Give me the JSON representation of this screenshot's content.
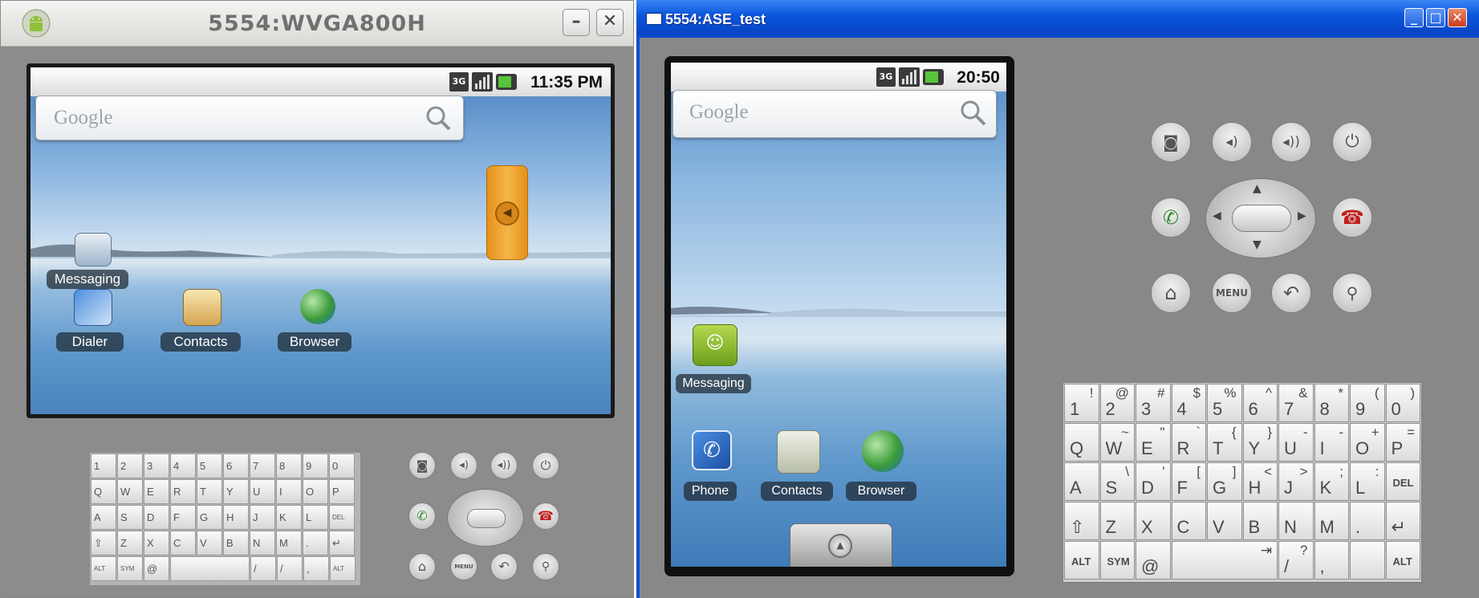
{
  "left_emulator": {
    "title": "5554:WVGA800H",
    "status_time": "11:35 PM",
    "search_placeholder": "Google",
    "apps": [
      {
        "label": "Messaging",
        "icon": "messaging-icon"
      },
      {
        "label": "Dialer",
        "icon": "dialer-icon"
      },
      {
        "label": "Contacts",
        "icon": "contacts-icon"
      },
      {
        "label": "Browser",
        "icon": "browser-icon"
      }
    ],
    "keyboard_rows": [
      [
        "1",
        "2",
        "3",
        "4",
        "5",
        "6",
        "7",
        "8",
        "9",
        "0"
      ],
      [
        "Q",
        "W",
        "E",
        "R",
        "T",
        "Y",
        "U",
        "I",
        "O",
        "P"
      ],
      [
        "A",
        "S",
        "D",
        "F",
        "G",
        "H",
        "J",
        "K",
        "L",
        "DEL"
      ],
      [
        "⇧",
        "Z",
        "X",
        "C",
        "V",
        "B",
        "N",
        "M",
        ".",
        "↵"
      ],
      [
        "ALT",
        "SYM",
        "@",
        "",
        "/",
        "/",
        ",",
        "ALT"
      ]
    ],
    "menu_label": "MENU"
  },
  "right_emulator": {
    "title": "5554:ASE_test",
    "status_time": "20:50",
    "search_placeholder": "Google",
    "apps": [
      {
        "label": "Messaging",
        "icon": "messaging-icon"
      },
      {
        "label": "Phone",
        "icon": "phone-icon"
      },
      {
        "label": "Contacts",
        "icon": "contacts-icon"
      },
      {
        "label": "Browser",
        "icon": "browser-icon"
      }
    ],
    "menu_label": "MENU",
    "keyboard": {
      "row1": [
        [
          "1",
          "!"
        ],
        [
          "2",
          "@"
        ],
        [
          "3",
          "#"
        ],
        [
          "4",
          "$"
        ],
        [
          "5",
          "%"
        ],
        [
          "6",
          "^"
        ],
        [
          "7",
          "&"
        ],
        [
          "8",
          "*"
        ],
        [
          "9",
          "("
        ],
        [
          "0",
          ")"
        ]
      ],
      "row2": [
        [
          "Q",
          ""
        ],
        [
          "W",
          "~"
        ],
        [
          "E",
          "\""
        ],
        [
          "R",
          "`"
        ],
        [
          "T",
          "{"
        ],
        [
          "Y",
          "}"
        ],
        [
          "U",
          "-"
        ],
        [
          "I",
          "-"
        ],
        [
          "O",
          "+"
        ],
        [
          "P",
          "="
        ]
      ],
      "row3": [
        [
          "A",
          ""
        ],
        [
          "S",
          "\\"
        ],
        [
          "D",
          "'"
        ],
        [
          "F",
          "["
        ],
        [
          "G",
          "]"
        ],
        [
          "H",
          "<"
        ],
        [
          "J",
          ">"
        ],
        [
          "K",
          ";"
        ],
        [
          "L",
          ":"
        ]
      ],
      "del_label": "DEL",
      "row4": [
        "⇧",
        "Z",
        "X",
        "C",
        "V",
        "B",
        "N",
        "M",
        ".",
        "↵"
      ],
      "alt_label": "ALT",
      "sym_label": "SYM",
      "at_label": "@",
      "slash_label": "/",
      "slash_shift": "?",
      "comma_label": ",",
      "tab_label": "⇥"
    }
  },
  "colors": {
    "xp_title": "#0a56dc",
    "emulator_body": "#888888",
    "screen_bezel": "#101010"
  }
}
